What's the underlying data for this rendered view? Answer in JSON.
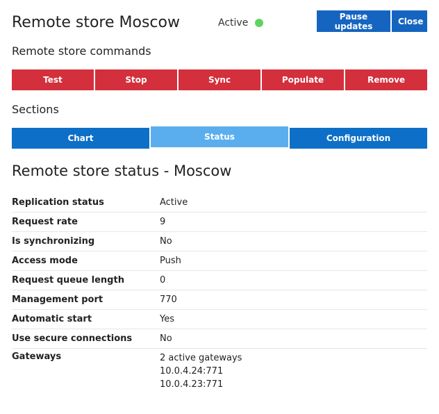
{
  "header": {
    "title": "Remote store Moscow",
    "status_text": "Active",
    "status_color": "#5fd35f",
    "pause_label": "Pause updates",
    "close_label": "Close"
  },
  "commands": {
    "title": "Remote store commands",
    "items": [
      "Test",
      "Stop",
      "Sync",
      "Populate",
      "Remove"
    ]
  },
  "sections": {
    "title": "Sections",
    "tabs": [
      "Chart",
      "Status",
      "Configuration"
    ],
    "active_tab": "Status"
  },
  "status": {
    "heading": "Remote store status - Moscow",
    "rows": [
      {
        "key": "Replication status",
        "value": "Active"
      },
      {
        "key": "Request rate",
        "value": "9"
      },
      {
        "key": "Is synchronizing",
        "value": "No"
      },
      {
        "key": "Access mode",
        "value": "Push"
      },
      {
        "key": "Request queue length",
        "value": "0"
      },
      {
        "key": "Management port",
        "value": "770"
      },
      {
        "key": "Automatic start",
        "value": "Yes"
      },
      {
        "key": "Use secure connections",
        "value": "No"
      }
    ],
    "gateways": {
      "key": "Gateways",
      "lines": [
        "2 active gateways",
        "10.0.4.24:771",
        "10.0.4.23:771"
      ]
    }
  },
  "colors": {
    "primary_blue": "#1565c0",
    "tab_blue": "#0d6fc7",
    "tab_active": "#5aaeee",
    "command_red": "#d32f3c"
  }
}
